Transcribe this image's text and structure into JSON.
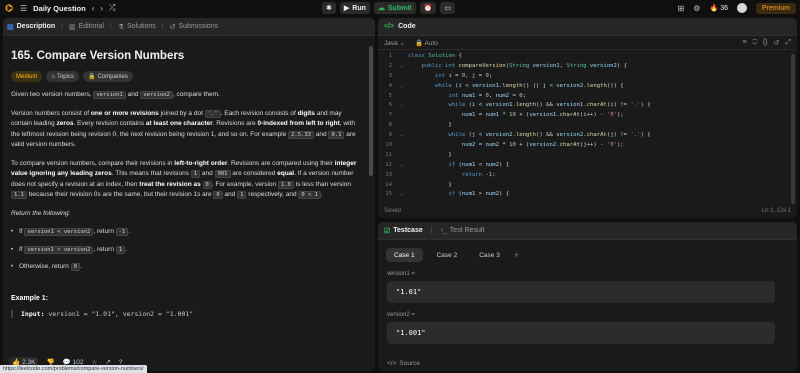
{
  "topbar": {
    "title": "Daily Question",
    "run": "Run",
    "submit": "Submit",
    "streak": "36",
    "premium": "Premium"
  },
  "left": {
    "tabs": [
      "Description",
      "Editorial",
      "Solutions",
      "Submissions"
    ],
    "title": "165. Compare Version Numbers",
    "solved": "Solved",
    "chips": [
      "Medium",
      "Topics",
      "Companies"
    ],
    "footer": {
      "likes": "2.3K",
      "comments": "102"
    },
    "status_url": "https://leetcode.com/problems/compare-version-numbers/"
  },
  "code": {
    "header": "Code",
    "language": "Java",
    "mode": "Auto",
    "saved": "Saved",
    "position": "Ln 1, Col 1"
  },
  "test": {
    "tabs": [
      "Testcase",
      "Test Result"
    ],
    "cases": [
      "Case 1",
      "Case 2",
      "Case 3"
    ],
    "params": [
      {
        "label": "version1 =",
        "value": "\"1.01\""
      },
      {
        "label": "version2 =",
        "value": "\"1.001\""
      }
    ],
    "source": "Source"
  },
  "colors": {
    "accent": "#ffa116",
    "green": "#2cbb5d",
    "background": "#0f0f0f",
    "panel": "#1a1a1a"
  }
}
